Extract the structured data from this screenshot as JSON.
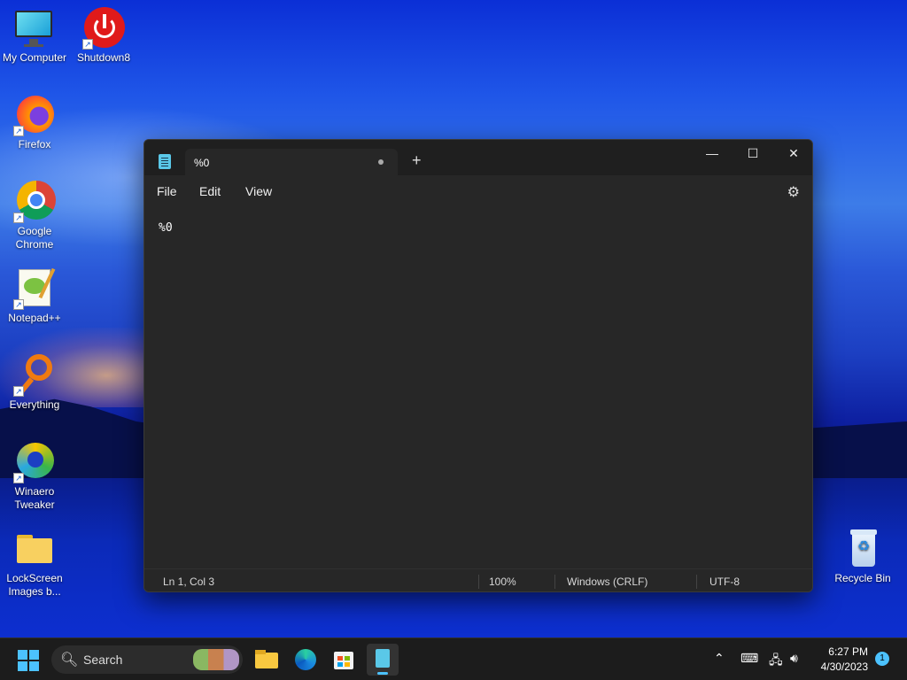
{
  "desktop": {
    "icons": [
      {
        "label": "My Computer",
        "icon": "monitor-icon"
      },
      {
        "label": "Shutdown8",
        "icon": "power-icon"
      },
      {
        "label": "Firefox",
        "icon": "firefox-icon"
      },
      {
        "label": "Google Chrome",
        "icon": "chrome-icon"
      },
      {
        "label": "Notepad++",
        "icon": "notepadpp-icon"
      },
      {
        "label": "Everything",
        "icon": "magnifier-icon"
      },
      {
        "label": "Winaero Tweaker",
        "icon": "winaero-icon"
      },
      {
        "label": "LockScreen Images b...",
        "icon": "folder-icon"
      },
      {
        "label": "Recycle Bin",
        "icon": "recycle-bin-icon"
      }
    ]
  },
  "notepad": {
    "tab_title": "%0",
    "new_tab_symbol": "+",
    "controls": {
      "minimize": "—",
      "maximize": "☐",
      "close": "✕"
    },
    "menu": {
      "file": "File",
      "edit": "Edit",
      "view": "View"
    },
    "content": "%0",
    "status": {
      "position": "Ln 1, Col 3",
      "zoom": "100%",
      "line_endings": "Windows (CRLF)",
      "encoding": "UTF-8"
    }
  },
  "taskbar": {
    "search_label": "Search",
    "apps": [
      "file-explorer-icon",
      "edge-icon",
      "store-icon",
      "notepad-icon"
    ],
    "clock_time": "6:27 PM",
    "clock_date": "4/30/2023",
    "notification_count": "1"
  },
  "colors": {
    "accent": "#4cc2ff",
    "window_bg": "#272727",
    "titlebar_bg": "#1f1f1f"
  }
}
